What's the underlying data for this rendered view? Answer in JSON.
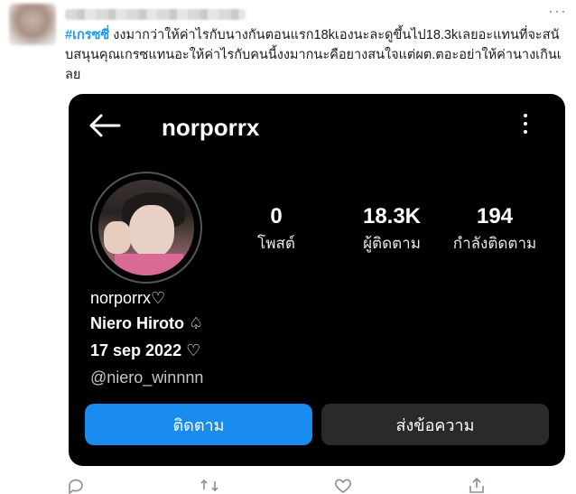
{
  "tweet": {
    "hashtag": "#เกรซซี่",
    "text": "งงมากว่าให้ค่าไรกับนางกันตอนแรก18kเองนะละดูขึ้นไป18.3kเลยอะแทนที่จะสนับสนุนคุณเกรซแทนอะให้ค่าไรกับคนนี้งงมากนะคือยางสนใจแต่ผต.ตอะอย่าให้ค่านางเกินเลย",
    "more_icon": "more-horizontal-icon"
  },
  "instagram": {
    "username": "norporrx",
    "stats": {
      "posts_value": "0",
      "posts_label": "โพสต์",
      "followers_value": "18.3K",
      "followers_label": "ผู้ติดตาม",
      "following_value": "194",
      "following_label": "กำลังติดตาม"
    },
    "bio": {
      "name": "norporrx♡",
      "display": "Niero Hiroto ♤",
      "date": "17 sep 2022 ♡",
      "handle": "@niero_winnnn"
    },
    "buttons": {
      "follow": "ติดตาม",
      "message": "ส่งข้อความ"
    },
    "colors": {
      "follow_button": "#1a8cf0",
      "message_button": "#2a2a2a",
      "background": "#000000"
    }
  },
  "actions": [
    "reply-icon",
    "retweet-icon",
    "like-icon",
    "share-icon"
  ]
}
